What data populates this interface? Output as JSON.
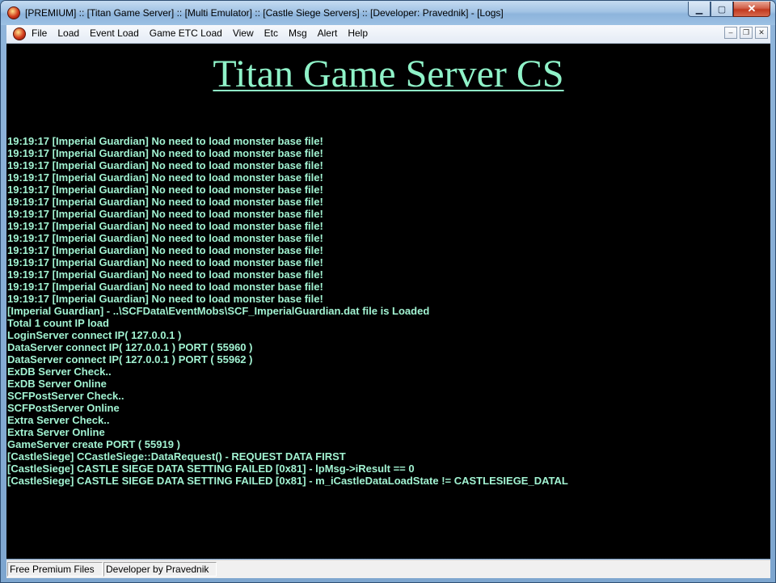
{
  "window": {
    "title": "[PREMIUM] :: [Titan Game Server] :: [Multi Emulator] :: [Castle Siege Servers] :: [Developer: Pravednik] - [Logs]",
    "app_icon_text": "TITAN"
  },
  "menu": {
    "items": [
      "File",
      "Load",
      "Event Load",
      "Game ETC Load",
      "View",
      "Etc",
      "Msg",
      "Alert",
      "Help"
    ]
  },
  "console": {
    "banner": "Titan Game Server CS",
    "text_color": "#a2f3d2",
    "banner_color": "#8ff2c8",
    "lines": [
      "19:19:17 [Imperial Guardian] No need to load monster base file!",
      "19:19:17 [Imperial Guardian] No need to load monster base file!",
      "19:19:17 [Imperial Guardian] No need to load monster base file!",
      "19:19:17 [Imperial Guardian] No need to load monster base file!",
      "19:19:17 [Imperial Guardian] No need to load monster base file!",
      "19:19:17 [Imperial Guardian] No need to load monster base file!",
      "19:19:17 [Imperial Guardian] No need to load monster base file!",
      "19:19:17 [Imperial Guardian] No need to load monster base file!",
      "19:19:17 [Imperial Guardian] No need to load monster base file!",
      "19:19:17 [Imperial Guardian] No need to load monster base file!",
      "19:19:17 [Imperial Guardian] No need to load monster base file!",
      "19:19:17 [Imperial Guardian] No need to load monster base file!",
      "19:19:17 [Imperial Guardian] No need to load monster base file!",
      "19:19:17 [Imperial Guardian] No need to load monster base file!",
      "[Imperial Guardian] - ..\\SCFData\\EventMobs\\SCF_ImperialGuardian.dat file is Loaded",
      "Total 1 count IP load",
      "LoginServer connect IP( 127.0.0.1 )",
      "DataServer connect IP( 127.0.0.1 ) PORT ( 55960 )",
      "DataServer connect IP( 127.0.0.1 ) PORT ( 55962 )",
      "ExDB Server Check..",
      "ExDB Server Online",
      "SCFPostServer Check..",
      "SCFPostServer Online",
      "Extra Server Check..",
      "Extra Server Online",
      "GameServer create PORT ( 55919 )",
      "[CastleSiege] CCastleSiege::DataRequest() - REQUEST DATA FIRST",
      "[CastleSiege] CASTLE SIEGE DATA SETTING FAILED [0x81] - lpMsg->iResult == 0",
      "[CastleSiege] CASTLE SIEGE DATA SETTING FAILED [0x81] - m_iCastleDataLoadState != CASTLESIEGE_DATAL"
    ]
  },
  "status": {
    "pane1": "Free Premium Files",
    "pane2": "Developer by Pravednik"
  }
}
